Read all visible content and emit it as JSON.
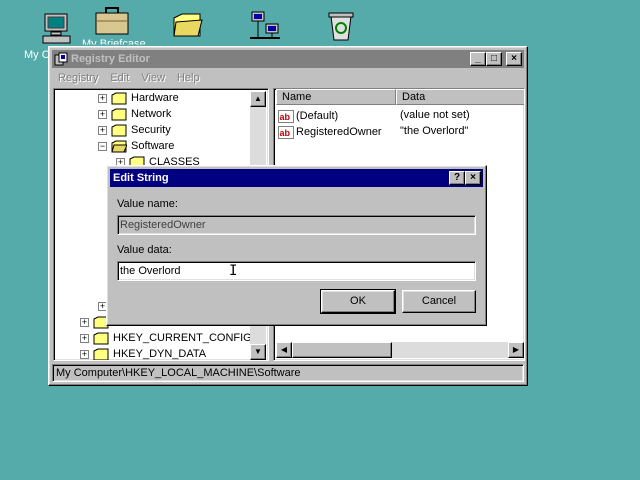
{
  "desktop": {
    "icons": [
      {
        "name": "my-computer",
        "label": "My Computer"
      },
      {
        "name": "my-briefcase",
        "label": "My Briefcase"
      },
      {
        "name": "folder",
        "label": ""
      },
      {
        "name": "network",
        "label": ""
      },
      {
        "name": "recycle-bin",
        "label": ""
      }
    ]
  },
  "window": {
    "title": "Registry Editor",
    "menu": [
      "Registry",
      "Edit",
      "View",
      "Help"
    ],
    "tree": [
      {
        "label": "Hardware",
        "expander": "+"
      },
      {
        "label": "Network",
        "expander": "+"
      },
      {
        "label": "Security",
        "expander": "+"
      },
      {
        "label": "Software",
        "expander": "−"
      },
      {
        "label": "CLASSES",
        "expander": "+"
      },
      {
        "label": "",
        "expander": "+"
      },
      {
        "label": "",
        "expander": "+"
      },
      {
        "label": "HKEY_CURRENT_CONFIG",
        "expander": "+"
      },
      {
        "label": "HKEY_DYN_DATA",
        "expander": "+"
      }
    ],
    "columns": {
      "name": "Name",
      "data": "Data"
    },
    "values": [
      {
        "name": "(Default)",
        "data": "(value not set)"
      },
      {
        "name": "RegisteredOwner",
        "data": "\"the Overlord\""
      }
    ],
    "status": "My Computer\\HKEY_LOCAL_MACHINE\\Software"
  },
  "dialog": {
    "title": "Edit String",
    "value_name_label": "Value name:",
    "value_name": "RegisteredOwner",
    "value_data_label": "Value data:",
    "value_data": "the Overlord",
    "ok_label": "OK",
    "cancel_label": "Cancel",
    "help_btn": "?",
    "close_btn": "×"
  },
  "titlebar_buttons": {
    "minimize": "_",
    "maximize": "□",
    "close": "×"
  },
  "colors": {
    "desktop": "#55aaaa",
    "active_title": "#000080",
    "inactive_title": "#808080",
    "face": "#c0c0c0"
  }
}
